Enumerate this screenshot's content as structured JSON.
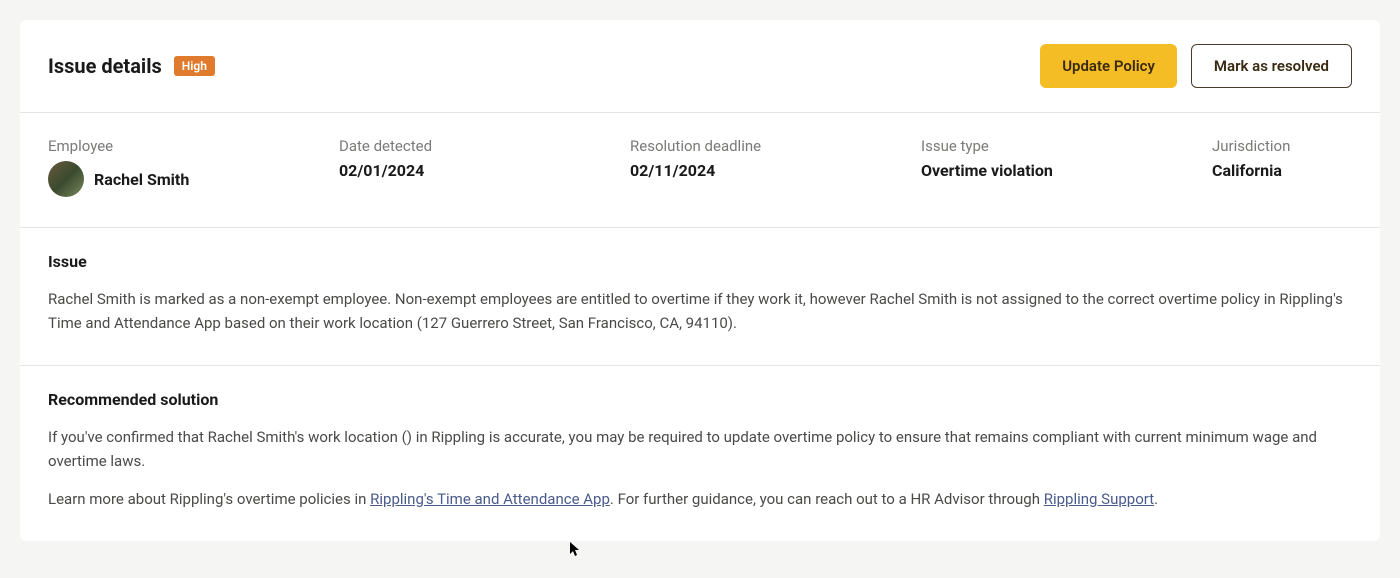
{
  "header": {
    "title": "Issue details",
    "badge": "High",
    "update_policy_label": "Update Policy",
    "mark_resolved_label": "Mark as resolved"
  },
  "meta": {
    "employee_label": "Employee",
    "employee_name": "Rachel Smith",
    "date_detected_label": "Date detected",
    "date_detected_value": "02/01/2024",
    "resolution_deadline_label": "Resolution deadline",
    "resolution_deadline_value": "02/11/2024",
    "issue_type_label": "Issue type",
    "issue_type_value": "Overtime violation",
    "jurisdiction_label": "Jurisdiction",
    "jurisdiction_value": "California"
  },
  "issue": {
    "heading": "Issue",
    "body": "Rachel Smith is marked as a non-exempt employee. Non-exempt employees are entitled to overtime if they work it, however Rachel Smith is not assigned to the correct overtime policy in Rippling's Time and Attendance App based on their work location (127 Guerrero Street, San Francisco, CA, 94110)."
  },
  "solution": {
    "heading": "Recommended solution",
    "body1": "If you've confirmed that Rachel Smith's work location () in Rippling is accurate, you may be required to update overtime policy to ensure that remains compliant with current minimum wage and overtime laws.",
    "line2_prefix": "Learn more about Rippling's overtime policies in ",
    "link1": "Rippling's Time and Attendance App",
    "line2_mid": ". For further guidance, you can reach out to a HR Advisor through ",
    "link2": "Rippling Support",
    "line2_suffix": "."
  }
}
